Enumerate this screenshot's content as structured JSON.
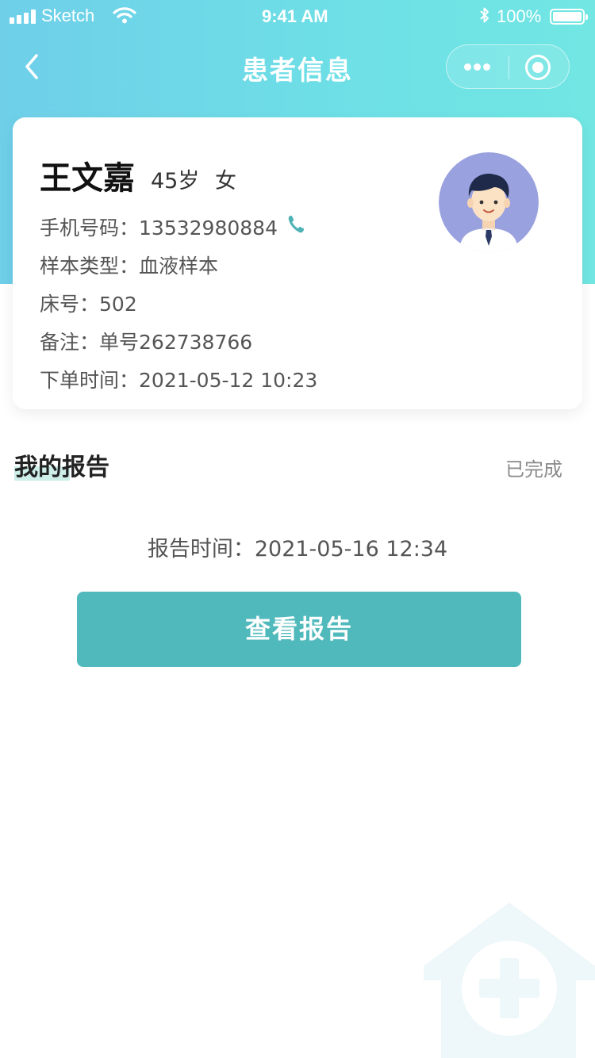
{
  "status_bar": {
    "carrier": "Sketch",
    "time": "9:41 AM",
    "battery": "100%"
  },
  "nav": {
    "title": "患者信息",
    "icons": {
      "back": "chevron-left-icon",
      "more": "more-dots-icon",
      "close": "target-circle-icon"
    }
  },
  "patient": {
    "name": "王文嘉",
    "age": "45岁",
    "gender": "女",
    "phone_label": "手机号码：",
    "phone": "13532980884",
    "sample_label": "样本类型：",
    "sample": "血液样本",
    "bed_label": "床号：",
    "bed": "502",
    "note_label": "备注：",
    "note": "单号262738766",
    "order_time_label": "下单时间：",
    "order_time": "2021-05-12 10:23"
  },
  "report": {
    "section_title": "我的报告",
    "status": "已完成",
    "time_label": "报告时间：",
    "time": "2021-05-16 12:34",
    "button": "查看报告"
  },
  "colors": {
    "header_gradient": [
      "#6fcfe9",
      "#71e6e3"
    ],
    "accent": "#50b9bb",
    "phone_icon": "#4fb3b6",
    "avatar_bg": "#9aa1df",
    "watermark": "#eef7f9"
  }
}
